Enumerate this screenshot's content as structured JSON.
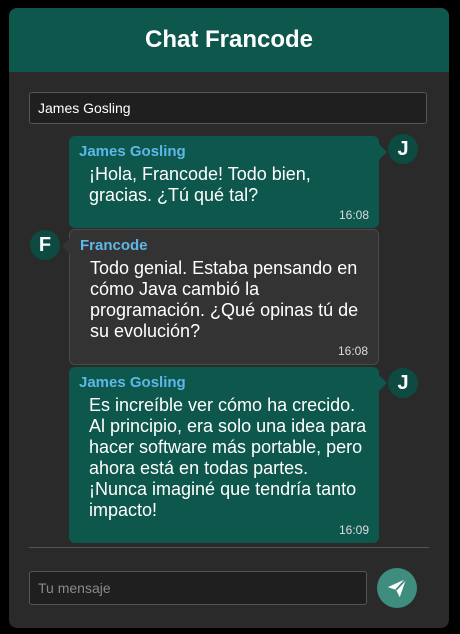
{
  "header": {
    "title": "Chat Francode"
  },
  "name_field": {
    "value": "James Gosling"
  },
  "messages": [
    {
      "sender": "James Gosling",
      "avatar": "J",
      "side": "sent",
      "text": "¡Hola, Francode! Todo bien, gracias. ¿Tú qué tal?",
      "time": "16:08"
    },
    {
      "sender": "Francode",
      "avatar": "F",
      "side": "recv",
      "text": "Todo genial. Estaba pensando en cómo Java cambió la programación. ¿Qué opinas tú de su evolución?",
      "time": "16:08"
    },
    {
      "sender": "James Gosling",
      "avatar": "J",
      "side": "sent",
      "text": "Es increíble ver cómo ha crecido. Al principio, era solo una idea para hacer software más portable, pero ahora está en todas partes. ¡Nunca imaginé que tendría tanto impacto!",
      "time": "16:09"
    }
  ],
  "composer": {
    "placeholder": "Tu mensaje",
    "send_icon": "paper-plane-icon"
  },
  "colors": {
    "header": "#0d574c",
    "sent_bubble": "#0d574c",
    "recv_bubble": "#333333",
    "sender_name": "#5db8e8",
    "send_button": "#3f8d7f"
  }
}
